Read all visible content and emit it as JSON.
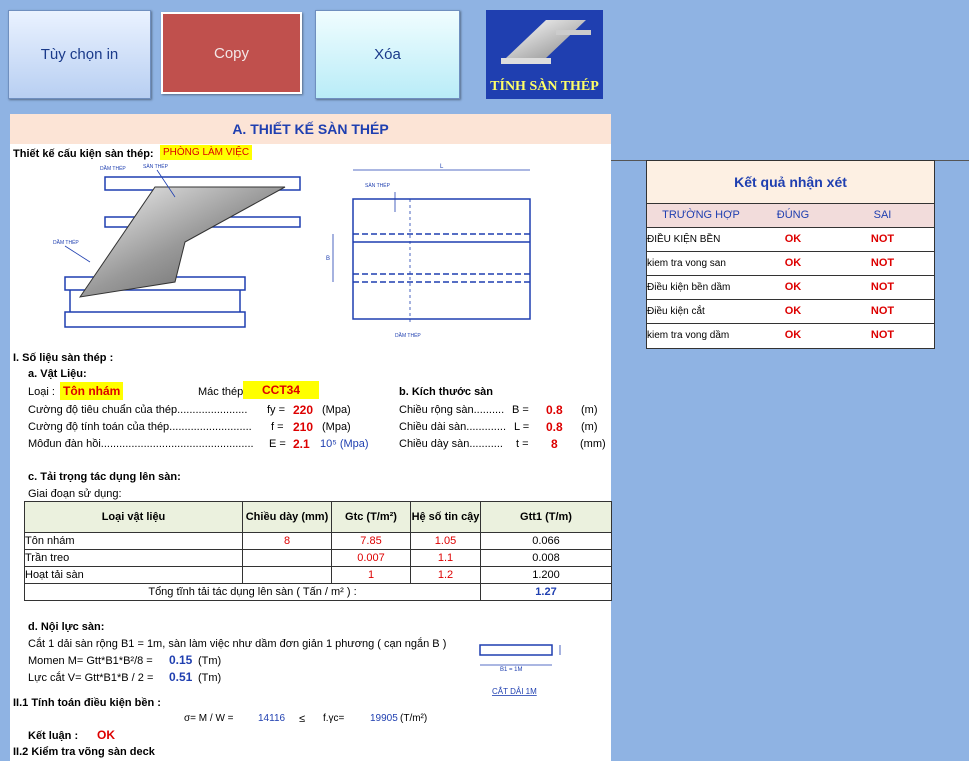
{
  "toolbar": {
    "print_label": "Tùy chọn in",
    "copy_label": "Copy",
    "delete_label": "Xóa",
    "logo_text": "TÍNH SÀN THÉP"
  },
  "sheet": {
    "title": "A. THIẾT KẾ SÀN THÉP",
    "design_label": "Thiết kế cấu kiện sàn thép:",
    "design_value": "PHÒNG LÀM VIỆC",
    "diagram": {
      "san_thep": "SÀN THÉP",
      "dam_thep": "DẦM THÉP",
      "dim_L": "L",
      "dim_B": "B"
    },
    "sec1": {
      "heading": "I.  Số liệu sàn thép :",
      "material_heading": "a. Vật Liệu:",
      "type_label": "Loại :",
      "type_value": "Tôn nhám",
      "steel_label": "Mác thép",
      "steel_value": "CCT34",
      "rows": [
        {
          "label": "Cường độ tiêu chuẩn của thép.......................",
          "sym": "fy =",
          "val": "220",
          "unit": "(Mpa)"
        },
        {
          "label": "Cường độ tính toán của thép...........................",
          "sym": "f =",
          "val": "210",
          "unit": "(Mpa)"
        },
        {
          "label": "Môđun đàn hồi..................................................",
          "sym": "E =",
          "val": "2.1",
          "unit": "10⁵ (Mpa)"
        }
      ],
      "size_heading": "b. Kích thước sàn",
      "sizes": [
        {
          "label": "Chiều rộng sàn..........",
          "sym": "B =",
          "val": "0.8",
          "unit": "(m)"
        },
        {
          "label": "Chiều dài sàn.............",
          "sym": "L =",
          "val": "0.8",
          "unit": "(m)"
        },
        {
          "label": "Chiều dày sàn...........",
          "sym": "t =",
          "val": "8",
          "unit": "(mm)"
        }
      ]
    },
    "loads": {
      "heading": "c. Tải trọng tác dụng lên sàn:",
      "phase": "Giai đoạn sử dụng:",
      "headers": [
        "Loại vật liệu",
        "Chiều dày (mm)",
        "Gtc (T/m²)",
        "Hệ số tin cậy",
        "Gtt1 (T/m)"
      ],
      "rows": [
        {
          "name": "Tôn nhám",
          "thick": "8",
          "gtc": "7.85",
          "k": "1.05",
          "gtt": "0.066"
        },
        {
          "name": "Trần treo",
          "thick": "",
          "gtc": "0.007",
          "k": "1.1",
          "gtt": "0.008"
        },
        {
          "name": "Hoạt tải sàn",
          "thick": "",
          "gtc": "1",
          "k": "1.2",
          "gtt": "1.200"
        }
      ],
      "total_label": "Tổng tĩnh tải tác dụng lên sàn ( Tấn / m² ) :",
      "total_value": "1.27"
    },
    "internal": {
      "heading": "d. Nội lực sàn:",
      "desc": "Cắt 1 dải sàn rộng B1 = 1m, sàn làm việc như dầm đơn giản 1 phương ( cạn ngắn B )",
      "moment_label": "Momen M= Gtt*B1*B²/8 =",
      "moment_value": "0.15",
      "moment_unit": "(Tm)",
      "shear_label": "Lực cắt  V= Gtt*B1*B / 2 =",
      "shear_value": "0.51",
      "shear_unit": "(Tm)",
      "strip_label": "B1 = 1M",
      "strip_caption": "CẮT DẢI 1M"
    },
    "check1": {
      "heading": "II.1  Tính toán điều kiện bền :",
      "formula": "σ= M / W   =",
      "sigma": "14116",
      "le": "≤",
      "fgc": "f.γc=",
      "fgc_value": "19905",
      "unit": "(T/m²)",
      "concl_label": "Kết luận :",
      "concl_value": "OK"
    },
    "check2": {
      "heading": "II.2  Kiểm tra võng sàn deck"
    }
  },
  "result": {
    "title": "Kết quả nhận xét",
    "headers": [
      "TRƯỜNG HỢP",
      "ĐÚNG",
      "SAI"
    ],
    "rows": [
      {
        "case": "ĐIỀU KIỆN BỀN",
        "ok": "OK",
        "not": "NOT"
      },
      {
        "case": "kiem tra vong san",
        "ok": "OK",
        "not": "NOT"
      },
      {
        "case": "Điều kiện bền dầm",
        "ok": "OK",
        "not": "NOT"
      },
      {
        "case": "Điều kiện cắt",
        "ok": "OK",
        "not": "NOT"
      },
      {
        "case": "kiem tra vong dầm",
        "ok": "OK",
        "not": "NOT"
      }
    ]
  }
}
